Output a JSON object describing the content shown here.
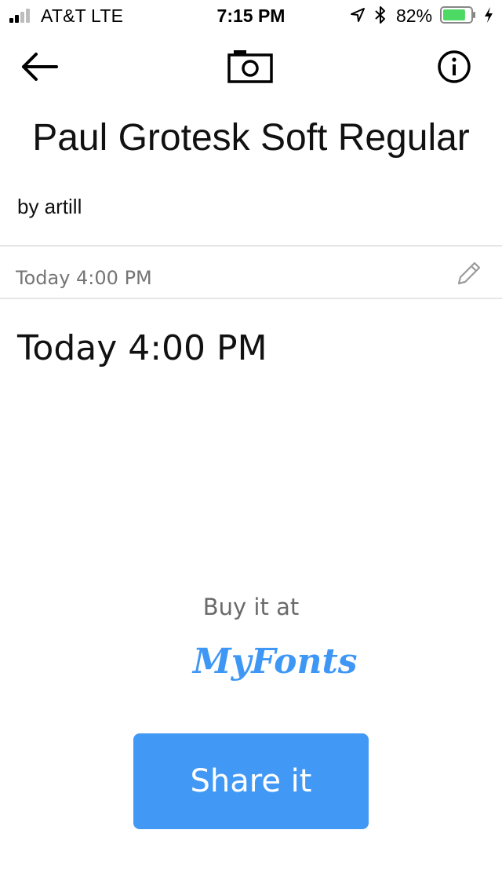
{
  "status_bar": {
    "carrier": "AT&T   LTE",
    "time": "7:15 PM",
    "battery_percent": "82%",
    "battery_level": 0.82,
    "icons": [
      "signal-icon",
      "location-icon",
      "bluetooth-icon",
      "battery-icon",
      "charging-icon"
    ]
  },
  "nav": {
    "icons": [
      "back-arrow-icon",
      "camera-icon",
      "info-icon"
    ]
  },
  "font": {
    "title": "Paul Grotesk Soft Regular",
    "author": "by artill"
  },
  "sample": {
    "placeholder": "Today 4:00 PM",
    "display_text": "Today 4:00 PM",
    "edit_icon": "pencil-icon"
  },
  "purchase": {
    "label": "Buy it at",
    "store_logo": "MyFonts"
  },
  "actions": {
    "share_label": "Share it"
  },
  "colors": {
    "accent": "#4299f5",
    "logo_blue": "#3f97f5",
    "battery_green": "#4cd964",
    "muted_text": "#9a9a9a",
    "divider": "#e6e6e6"
  }
}
